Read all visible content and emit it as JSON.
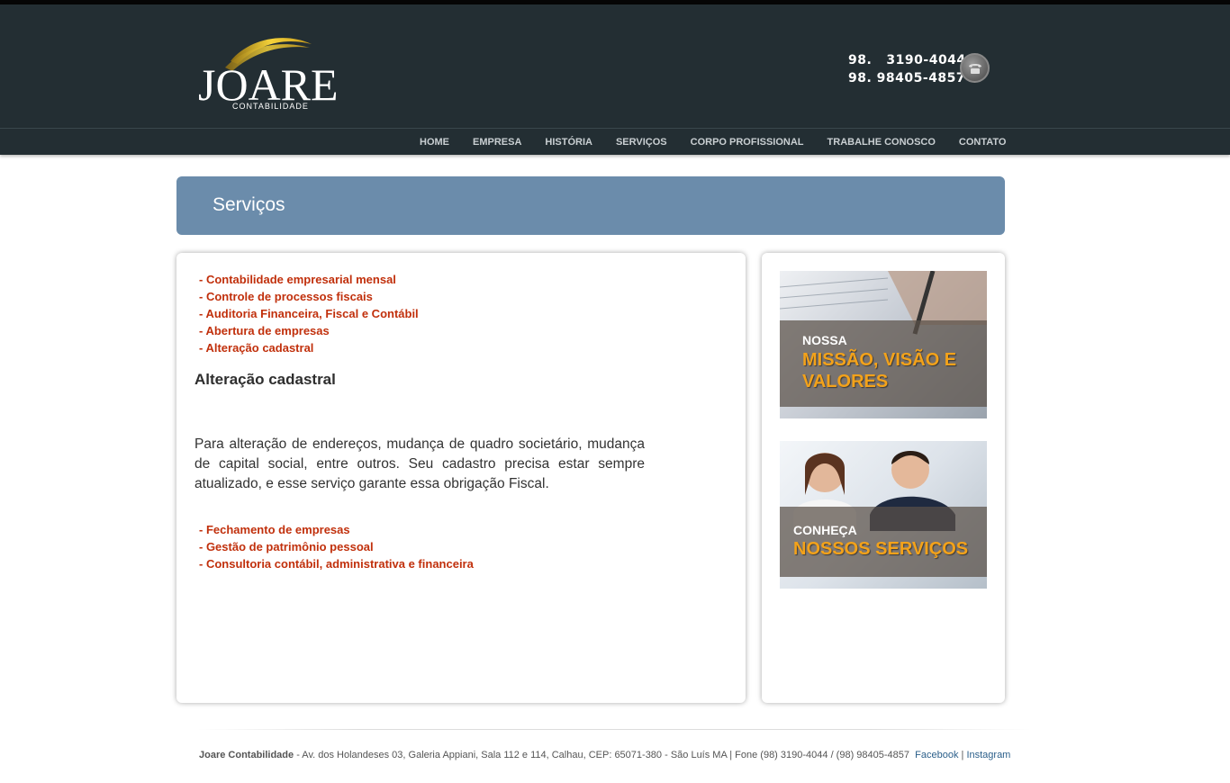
{
  "header": {
    "logo_text": "JOARE",
    "logo_sub": "CONTABILIDADE",
    "phone_1": "98.   3190-4044",
    "phone_2": "98. 98405-4857",
    "icon": "phone-icon"
  },
  "nav": {
    "items": [
      "HOME",
      "EMPRESA",
      "HISTÓRIA",
      "SERVIÇOS",
      "CORPO PROFISSIONAL",
      "TRABALHE CONOSCO",
      "CONTATO"
    ]
  },
  "banner": {
    "title": "Serviços"
  },
  "services_top": [
    "- Contabilidade empresarial mensal",
    "- Controle de processos fiscais",
    "- Auditoria Financeira, Fiscal e Contábil",
    "- Abertura de empresas",
    "- Alteração cadastral"
  ],
  "section": {
    "title": "Alteração cadastral",
    "text": "Para alteração de endereços, mudança de quadro societário, mudança de capital social, entre outros. Seu cadastro precisa estar sempre atualizado, e esse serviço garante essa obrigação Fiscal."
  },
  "services_bottom": [
    "- Fechamento de empresas",
    "- Gestão de patrimônio pessoal",
    "- Consultoria contábil, administrativa e financeira"
  ],
  "sidebar": {
    "mission": {
      "kicker": "NOSSA",
      "headline": "MISSÃO, VISÃO E VALORES"
    },
    "services": {
      "kicker": "CONHEÇA",
      "headline": "NOSSOS SERVIÇOS"
    }
  },
  "footer": {
    "brand": "Joare Contabilidade",
    "address": " - Av. dos Holandeses 03, Galeria Appiani, Sala 112 e 114, Calhau, CEP: 65071-380 - São Luís MA | Fone (98) 3190-4044 / (98) 98405-4857  ",
    "facebook": "Facebook",
    "separator": " | ",
    "instagram": "Instagram"
  },
  "colors": {
    "header_bg": "#232e33",
    "banner_bg": "#6b8cab",
    "service_link": "#c1300c",
    "promo_accent": "#f3a21a"
  }
}
